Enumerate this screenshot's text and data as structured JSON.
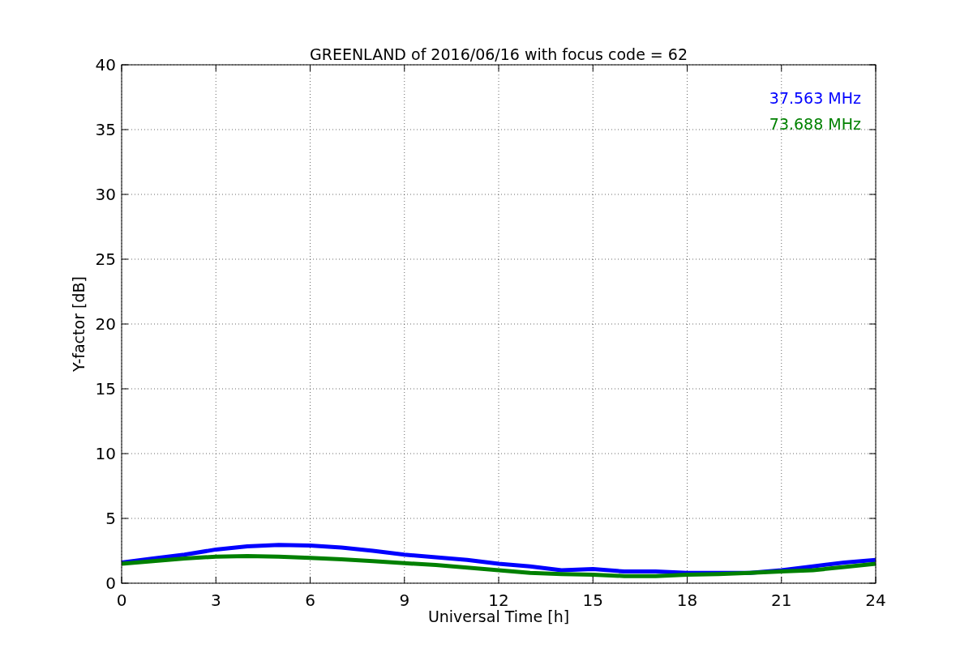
{
  "chart_data": {
    "type": "line",
    "title": "GREENLAND of 2016/06/16 with focus code = 62",
    "xlabel": "Universal Time [h]",
    "ylabel": "Y-factor [dB]",
    "x": [
      0,
      1,
      2,
      3,
      4,
      5,
      6,
      7,
      8,
      9,
      10,
      11,
      12,
      13,
      14,
      15,
      16,
      17,
      18,
      19,
      20,
      21,
      22,
      23,
      24
    ],
    "series": [
      {
        "name": "37.563 MHz",
        "color": "#0000ff",
        "values": [
          1.6,
          1.9,
          2.2,
          2.6,
          2.85,
          2.95,
          2.9,
          2.75,
          2.5,
          2.2,
          2.0,
          1.8,
          1.5,
          1.3,
          1.0,
          1.1,
          0.9,
          0.9,
          0.8,
          0.8,
          0.8,
          1.0,
          1.3,
          1.6,
          1.8
        ]
      },
      {
        "name": "73.688 MHz",
        "color": "#008000",
        "values": [
          1.5,
          1.7,
          1.9,
          2.05,
          2.1,
          2.05,
          1.95,
          1.85,
          1.7,
          1.55,
          1.4,
          1.2,
          1.0,
          0.8,
          0.7,
          0.65,
          0.55,
          0.55,
          0.65,
          0.7,
          0.8,
          0.9,
          1.0,
          1.25,
          1.5
        ]
      }
    ],
    "grid": true,
    "xlim": [
      0,
      24
    ],
    "ylim": [
      0,
      40
    ],
    "xticks": [
      0,
      3,
      6,
      9,
      12,
      15,
      18,
      21,
      24
    ],
    "yticks": [
      0,
      5,
      10,
      15,
      20,
      25,
      30,
      35,
      40
    ]
  }
}
